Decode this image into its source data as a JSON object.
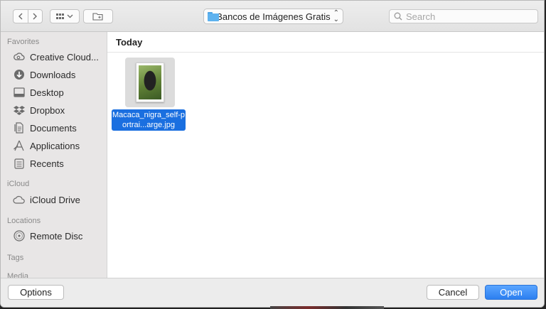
{
  "toolbar": {
    "back_label": "<",
    "forward_label": ">",
    "view_label": "88 ▾",
    "location_label": "Bancos de Imágenes Gratis",
    "search_placeholder": "Search"
  },
  "sidebar": {
    "sections": [
      {
        "title": "Favorites"
      },
      {
        "title": "iCloud"
      },
      {
        "title": "Locations"
      },
      {
        "title": "Tags"
      },
      {
        "title": "Media"
      }
    ],
    "favorites": [
      {
        "label": "Creative Cloud...",
        "icon": "creative-cloud-icon"
      },
      {
        "label": "Downloads",
        "icon": "downloads-icon"
      },
      {
        "label": "Desktop",
        "icon": "desktop-icon"
      },
      {
        "label": "Dropbox",
        "icon": "dropbox-icon"
      },
      {
        "label": "Documents",
        "icon": "documents-icon"
      },
      {
        "label": "Applications",
        "icon": "applications-icon"
      },
      {
        "label": "Recents",
        "icon": "recents-icon"
      }
    ],
    "icloud": [
      {
        "label": "iCloud Drive",
        "icon": "cloud-icon"
      }
    ],
    "locations": [
      {
        "label": "Remote Disc",
        "icon": "disc-icon"
      }
    ]
  },
  "main": {
    "group_header": "Today",
    "files": [
      {
        "name": "Macaca_nigra_self-portrai...arge.jpg",
        "selected": true
      }
    ]
  },
  "footer": {
    "options_label": "Options",
    "cancel_label": "Cancel",
    "open_label": "Open"
  },
  "colors": {
    "accent": "#1a6fe0",
    "open_button": "#2c7ff0",
    "sidebar_bg": "#e8e6e6"
  }
}
